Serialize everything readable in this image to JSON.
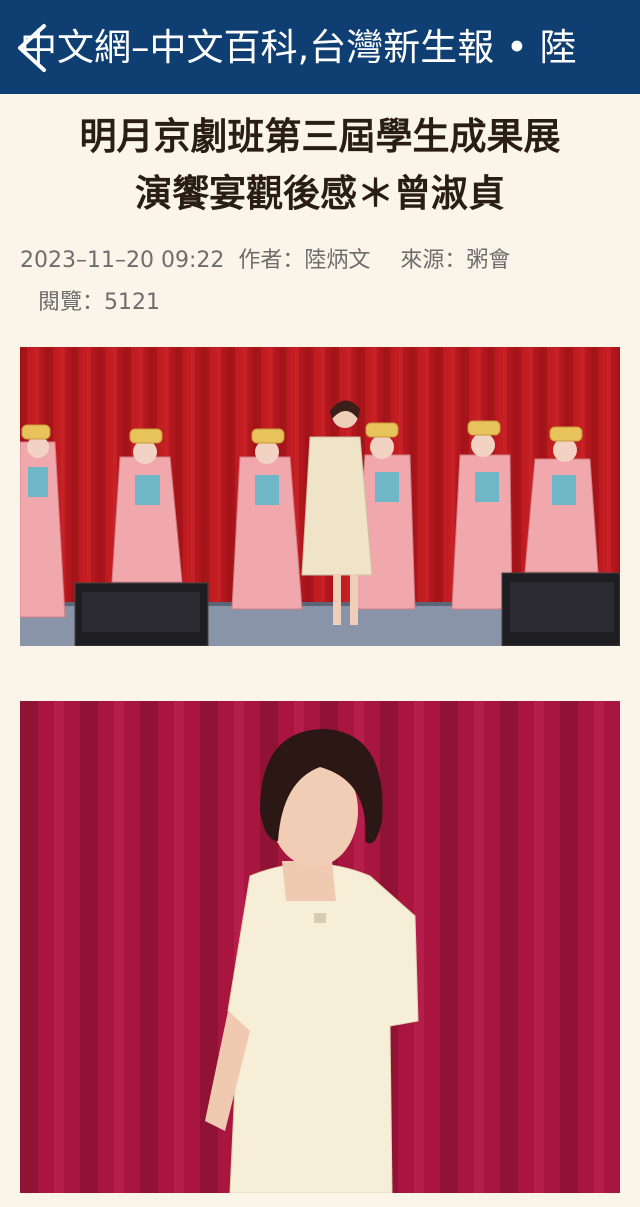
{
  "header": {
    "site_title": "中文網–中文百科,台灣新生報 • 陸"
  },
  "article": {
    "title_line1": "明月京劇班第三屆學生成果展",
    "title_line2": "演饗宴觀後感＊曾淑貞",
    "datetime": "2023–11–20 09:22",
    "author_label": "作者：",
    "author": "陸炳文",
    "source_label": "來源：",
    "source": "粥會",
    "views_label": "閱覽：",
    "views": "5121"
  },
  "colors": {
    "header_bg": "#0f3f72",
    "page_bg": "#fbf5e9",
    "title_text": "#2a1d12",
    "meta_text": "#6d6d6d"
  },
  "icons": {
    "back": "chevron-left-icon"
  }
}
